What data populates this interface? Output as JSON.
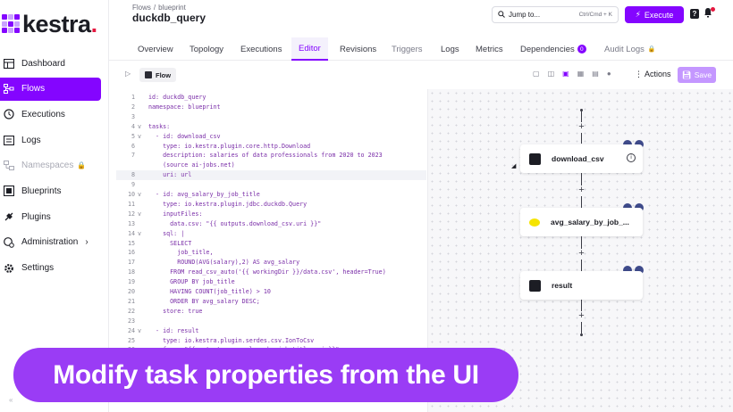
{
  "app": {
    "logo_text": "kestra",
    "logo_dot": "."
  },
  "sidebar": {
    "items": [
      {
        "label": "Dashboard",
        "icon": "dashboard-icon"
      },
      {
        "label": "Flows",
        "icon": "flows-icon",
        "active": true
      },
      {
        "label": "Executions",
        "icon": "history-icon"
      },
      {
        "label": "Logs",
        "icon": "logs-icon"
      },
      {
        "label": "Namespaces",
        "icon": "namespaces-icon",
        "disabled": true,
        "locked": true
      },
      {
        "label": "Blueprints",
        "icon": "blueprints-icon"
      },
      {
        "label": "Plugins",
        "icon": "plugins-icon"
      },
      {
        "label": "Administration",
        "icon": "admin-icon",
        "chevron": "›"
      },
      {
        "label": "Settings",
        "icon": "gear-icon"
      }
    ]
  },
  "header": {
    "breadcrumb": [
      "Flows",
      "blueprint"
    ],
    "breadcrumb_sep": "/",
    "title": "duckdb_query",
    "jump_label": "Jump to...",
    "jump_shortcut": "Ctrl/Cmd + K",
    "execute_label": "Execute",
    "help_label": "?"
  },
  "tabs": [
    {
      "label": "Overview"
    },
    {
      "label": "Topology"
    },
    {
      "label": "Executions"
    },
    {
      "label": "Editor",
      "active": true
    },
    {
      "label": "Revisions"
    },
    {
      "label": "Triggers",
      "muted": true
    },
    {
      "label": "Logs"
    },
    {
      "label": "Metrics"
    },
    {
      "label": "Dependencies",
      "count": "0"
    },
    {
      "label": "Audit Logs",
      "locked": true,
      "muted": true
    }
  ],
  "editor_toolbar": {
    "chip_label": "Flow",
    "actions_label": "Actions",
    "save_label": "Save"
  },
  "code": {
    "lines": [
      {
        "n": "1",
        "fold": "",
        "text": "id: duckdb_query"
      },
      {
        "n": "2",
        "fold": "",
        "text": "namespace: blueprint"
      },
      {
        "n": "3",
        "fold": "",
        "text": ""
      },
      {
        "n": "4",
        "fold": "v",
        "text": "tasks:"
      },
      {
        "n": "5",
        "fold": "v",
        "text": "  - id: download_csv"
      },
      {
        "n": "6",
        "fold": "",
        "text": "    type: io.kestra.plugin.core.http.Download"
      },
      {
        "n": "7",
        "fold": "",
        "text": "    description: salaries of data professionals from 2020 to 2023"
      },
      {
        "n": "",
        "fold": "",
        "text": "    (source ai-jobs.net)"
      },
      {
        "n": "8",
        "fold": "",
        "text": "    uri: url",
        "hl": true
      },
      {
        "n": "9",
        "fold": "",
        "text": ""
      },
      {
        "n": "10",
        "fold": "v",
        "text": "  - id: avg_salary_by_job_title"
      },
      {
        "n": "11",
        "fold": "",
        "text": "    type: io.kestra.plugin.jdbc.duckdb.Query"
      },
      {
        "n": "12",
        "fold": "v",
        "text": "    inputFiles:"
      },
      {
        "n": "13",
        "fold": "",
        "text": "      data.csv: \"{{ outputs.download_csv.uri }}\""
      },
      {
        "n": "14",
        "fold": "v",
        "text": "    sql: |"
      },
      {
        "n": "15",
        "fold": "",
        "text": "      SELECT"
      },
      {
        "n": "16",
        "fold": "",
        "text": "        job_title,"
      },
      {
        "n": "17",
        "fold": "",
        "text": "        ROUND(AVG(salary),2) AS avg_salary"
      },
      {
        "n": "18",
        "fold": "",
        "text": "      FROM read_csv_auto('{{ workingDir }}/data.csv', header=True)"
      },
      {
        "n": "19",
        "fold": "",
        "text": "      GROUP BY job_title"
      },
      {
        "n": "20",
        "fold": "",
        "text": "      HAVING COUNT(job_title) > 10"
      },
      {
        "n": "21",
        "fold": "",
        "text": "      ORDER BY avg_salary DESC;"
      },
      {
        "n": "22",
        "fold": "",
        "text": "    store: true"
      },
      {
        "n": "23",
        "fold": "",
        "text": ""
      },
      {
        "n": "24",
        "fold": "v",
        "text": "  - id: result"
      },
      {
        "n": "25",
        "fold": "",
        "text": "    type: io.kestra.plugin.serdes.csv.IonToCsv"
      },
      {
        "n": "26",
        "fold": "",
        "text": "    from: \"{{ outputs.avg_salary_by_job_title.uri }}\""
      }
    ]
  },
  "canvas": {
    "nodes": [
      {
        "label": "download_csv",
        "icon": "download-icon",
        "info": "i"
      },
      {
        "label": "avg_salary_by_job_...",
        "icon": "duckdb-icon"
      },
      {
        "label": "result",
        "icon": "csv-icon"
      }
    ],
    "plus_symbol": "+"
  },
  "banner": {
    "text": "Modify task properties from the UI"
  },
  "colors": {
    "brand": "#8405ff",
    "banner": "#9a3cf5",
    "save_disabled": "#c497ff",
    "logo_dot": "#e5183f"
  }
}
